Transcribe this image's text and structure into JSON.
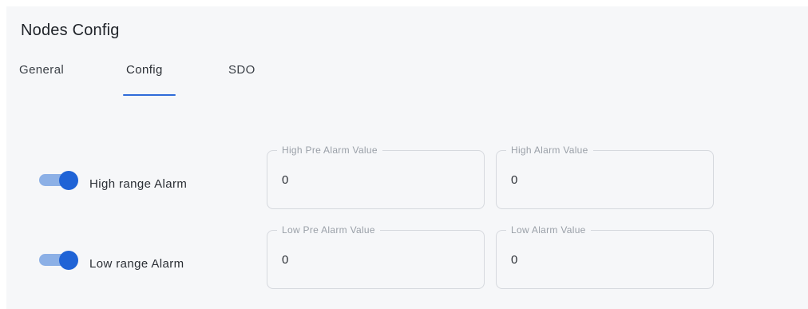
{
  "title": "Nodes Config",
  "tabs": [
    {
      "label": "General",
      "active": false
    },
    {
      "label": "Config",
      "active": true
    },
    {
      "label": "SDO",
      "active": false
    }
  ],
  "colors": {
    "accent": "#1f63d6",
    "toggle_track": "#8cb0e6",
    "panel_bg": "#f6f7f9"
  },
  "alarms": {
    "high": {
      "label": "High range Alarm",
      "enabled": true,
      "pre_alarm": {
        "label": "High Pre Alarm Value",
        "value": "0"
      },
      "alarm": {
        "label": "High Alarm Value",
        "value": "0"
      }
    },
    "low": {
      "label": "Low range Alarm",
      "enabled": true,
      "pre_alarm": {
        "label": "Low Pre Alarm Value",
        "value": "0"
      },
      "alarm": {
        "label": "Low Alarm Value",
        "value": "0"
      }
    }
  }
}
